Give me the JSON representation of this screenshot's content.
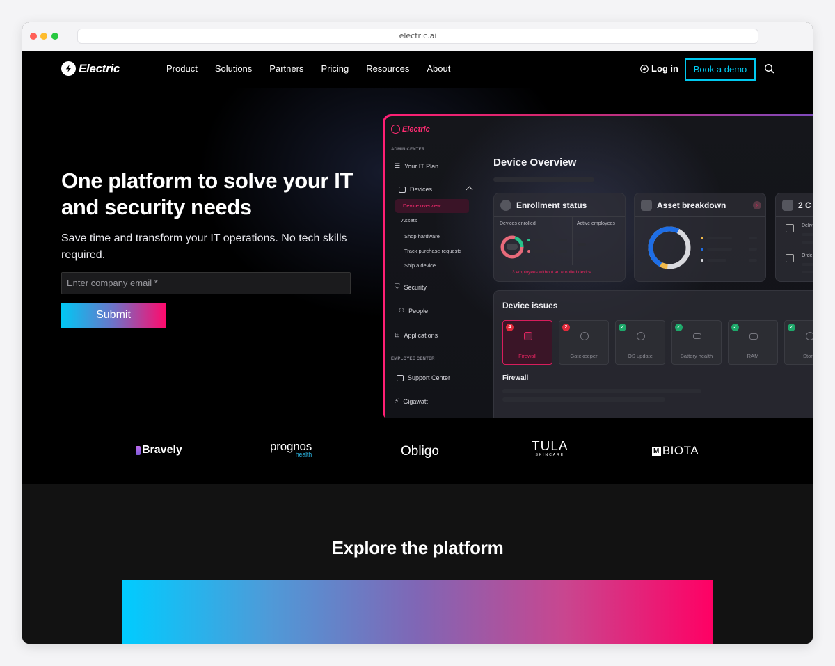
{
  "browser": {
    "url": "electric.ai"
  },
  "nav": {
    "brand": "Electric",
    "links": [
      "Product",
      "Solutions",
      "Partners",
      "Pricing",
      "Resources",
      "About"
    ],
    "login": "Log in",
    "demo": "Book a demo"
  },
  "hero": {
    "title": "One platform to solve your IT and security needs",
    "subtitle": "Save time and transform your IT operations. No tech skills required.",
    "email_placeholder": "Enter company email *",
    "submit": "Submit"
  },
  "mockup": {
    "brand": "Electric",
    "admin_section": "ADMIN CENTER",
    "employee_section": "EMPLOYEE CENTER",
    "nav": {
      "it_plan": "Your IT Plan",
      "devices": "Devices",
      "device_overview": "Device overview",
      "assets": "Assets",
      "shop_hardware": "Shop hardware",
      "track_requests": "Track purchase requests",
      "ship_device": "Ship a device",
      "security": "Security",
      "people": "People",
      "applications": "Applications",
      "support_center": "Support Center",
      "gigawatt": "Gigawatt"
    },
    "title": "Device Overview",
    "enrollment": {
      "title": "Enrollment status",
      "devices_enrolled": "Devices enrolled",
      "active_employees": "Active employees",
      "warning": "3 employees without an enrolled device"
    },
    "asset": {
      "title": "Asset breakdown"
    },
    "third_card": {
      "title": "2 C",
      "row1": "Deliv",
      "row2": "Orde"
    },
    "issues": {
      "title": "Device issues",
      "items": [
        {
          "label": "Firewall",
          "badge": "4",
          "status": "error"
        },
        {
          "label": "Gatekeeper",
          "badge": "2",
          "status": "error"
        },
        {
          "label": "OS update",
          "badge": "✓",
          "status": "ok"
        },
        {
          "label": "Battery health",
          "badge": "✓",
          "status": "ok"
        },
        {
          "label": "RAM",
          "badge": "✓",
          "status": "ok"
        },
        {
          "label": "Stora",
          "badge": "✓",
          "status": "ok"
        }
      ],
      "selected_detail": "Firewall"
    }
  },
  "logos": [
    "Bravely",
    "prognos",
    "health",
    "Obligo",
    "TULA",
    "SKINCARE",
    "M",
    "BIOTA"
  ],
  "explore": {
    "title": "Explore the platform"
  },
  "colors": {
    "accent_cyan": "#00c9f0",
    "accent_pink": "#ff0a6c"
  }
}
